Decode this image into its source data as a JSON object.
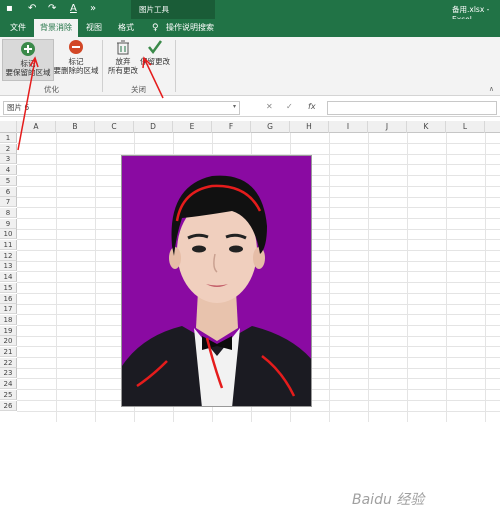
{
  "titlebar": {
    "tools_context": "图片工具",
    "window_title": "备用.xlsx - Excel"
  },
  "tabs": [
    "文件",
    "背景消除",
    "视图",
    "格式"
  ],
  "tell_me": "操作说明搜索",
  "ribbon": {
    "mark_keep": "标记\n要保留的区域",
    "mark_remove": "标记\n要删除的区域",
    "discard": "放弃\n所有更改",
    "keep_changes": "保留更改",
    "group_optimize": "优化",
    "group_close": "关闭"
  },
  "formula_bar": {
    "name_box": "图片 6",
    "fx": "fx"
  },
  "columns": [
    "A",
    "B",
    "C",
    "D",
    "E",
    "F",
    "G",
    "H",
    "I",
    "J",
    "K",
    "L"
  ],
  "rows": [
    "1",
    "2",
    "3",
    "4",
    "5",
    "6",
    "7",
    "8",
    "9",
    "10",
    "11",
    "12",
    "13",
    "14",
    "15",
    "16",
    "17",
    "18",
    "19",
    "20",
    "21",
    "22",
    "23",
    "24",
    "25",
    "26"
  ],
  "watermark": "Baidu 经验",
  "colors": {
    "excel_green": "#217346",
    "photo_bg": "#8a0aa2",
    "marker": "#e51c1c"
  }
}
